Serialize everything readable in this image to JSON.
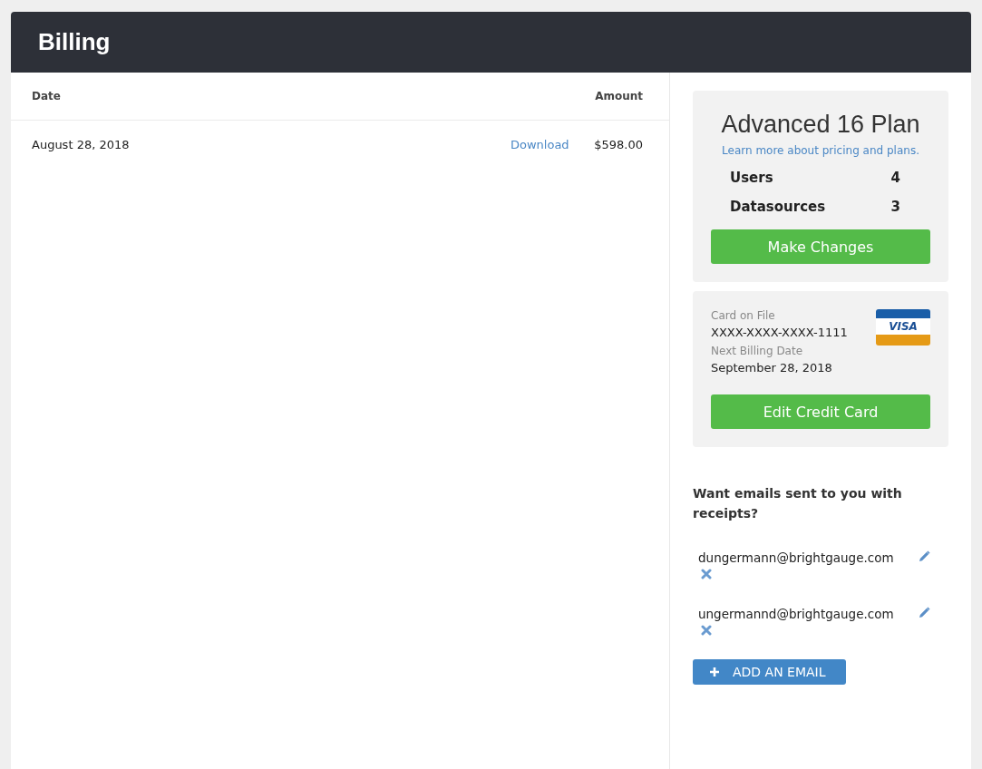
{
  "header": {
    "title": "Billing"
  },
  "table": {
    "columns": [
      "Date",
      "Amount"
    ],
    "rows": [
      {
        "date": "August 28, 2018",
        "link": "Download",
        "amount": "$598.00"
      }
    ]
  },
  "plan": {
    "name": "Advanced 16 Plan",
    "link": "Learn more about pricing and plans.",
    "stats": [
      {
        "label": "Users",
        "value": "4"
      },
      {
        "label": "Datasources",
        "value": "3"
      }
    ],
    "button": "Make Changes"
  },
  "card": {
    "fields": [
      {
        "label": "Card on File",
        "value": "XXXX-XXXX-XXXX-1111"
      },
      {
        "label": "Next Billing Date",
        "value": "September 28, 2018"
      }
    ],
    "brand": "VISA",
    "button": "Edit Credit Card"
  },
  "emails": {
    "heading": "Want emails sent to you with receipts?",
    "items": [
      "dungermann@brightgauge.com",
      "ungermannd@brightgauge.com"
    ],
    "add_button": "ADD AN EMAIL"
  }
}
